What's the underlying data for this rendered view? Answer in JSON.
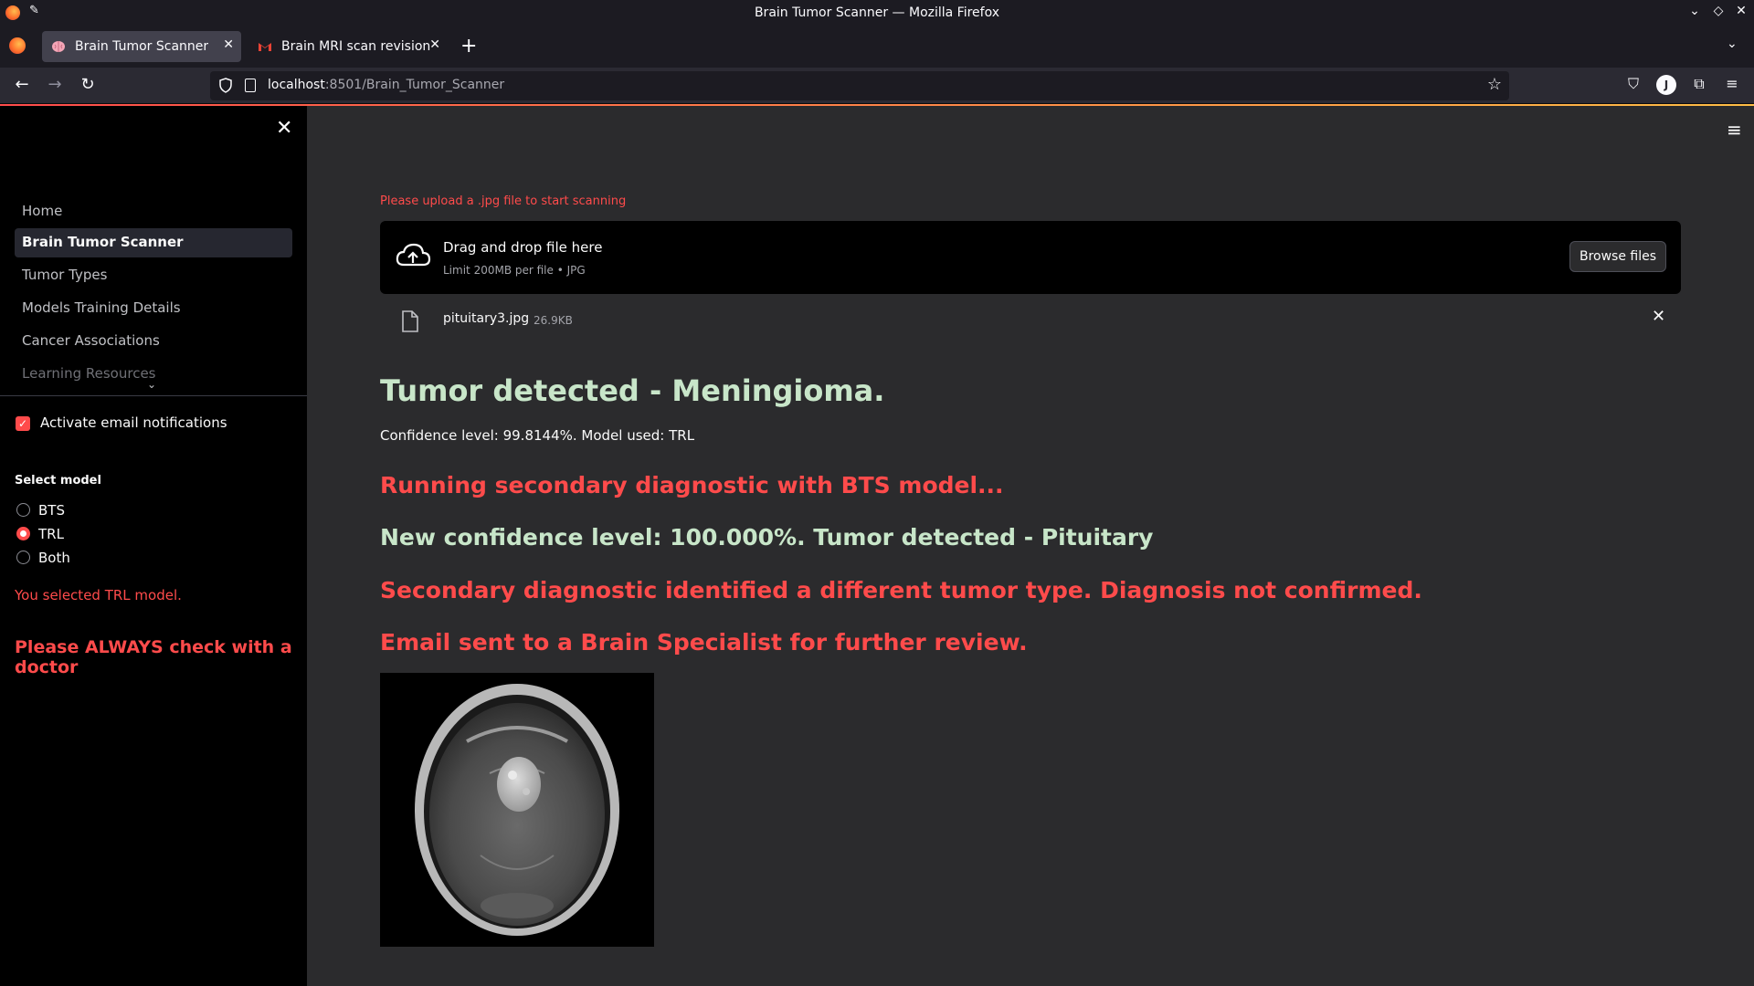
{
  "window": {
    "title": "Brain Tumor Scanner — Mozilla Firefox"
  },
  "tabs": [
    {
      "label": "Brain Tumor Scanner",
      "icon": "brain-icon",
      "active": true
    },
    {
      "label": "Brain MRI scan revision ne",
      "icon": "gmail-icon",
      "active": false
    }
  ],
  "urlbar": {
    "host": "localhost",
    "rest": ":8501/Brain_Tumor_Scanner"
  },
  "sidebar": {
    "nav": [
      {
        "label": "Home"
      },
      {
        "label": "Brain Tumor Scanner"
      },
      {
        "label": "Tumor Types"
      },
      {
        "label": "Models Training Details"
      },
      {
        "label": "Cancer Associations"
      },
      {
        "label": "Learning Resources"
      }
    ],
    "email_notifications_label": "Activate email notifications",
    "email_notifications_checked": true,
    "select_model_label": "Select model",
    "models": [
      {
        "label": "BTS",
        "selected": false
      },
      {
        "label": "TRL",
        "selected": true
      },
      {
        "label": "Both",
        "selected": false
      }
    ],
    "selected_message": "You selected TRL model.",
    "doctor_message": "Please ALWAYS check with a doctor"
  },
  "uploader": {
    "hint": "Please upload a .jpg file to start scanning",
    "title": "Drag and drop file here",
    "subtitle": "Limit 200MB per file • JPG",
    "browse_label": "Browse files",
    "file_name": "pituitary3.jpg",
    "file_size": "26.9KB"
  },
  "results": {
    "detected": "Tumor detected - Meningioma.",
    "confidence": "Confidence level: 99.8144%. Model used: TRL",
    "secondary_running": "Running secondary diagnostic with BTS model...",
    "new_confidence": "New confidence level: 100.000%. Tumor detected - Pituitary",
    "mismatch": "Secondary diagnostic identified a different tumor type. Diagnosis not confirmed.",
    "email_sent": "Email sent to a Brain Specialist for further review."
  },
  "colors": {
    "accent": "#ff4b4b",
    "success_text": "#c8e6c9",
    "sidebar_bg": "#000000",
    "main_bg": "#2b2b2d"
  }
}
